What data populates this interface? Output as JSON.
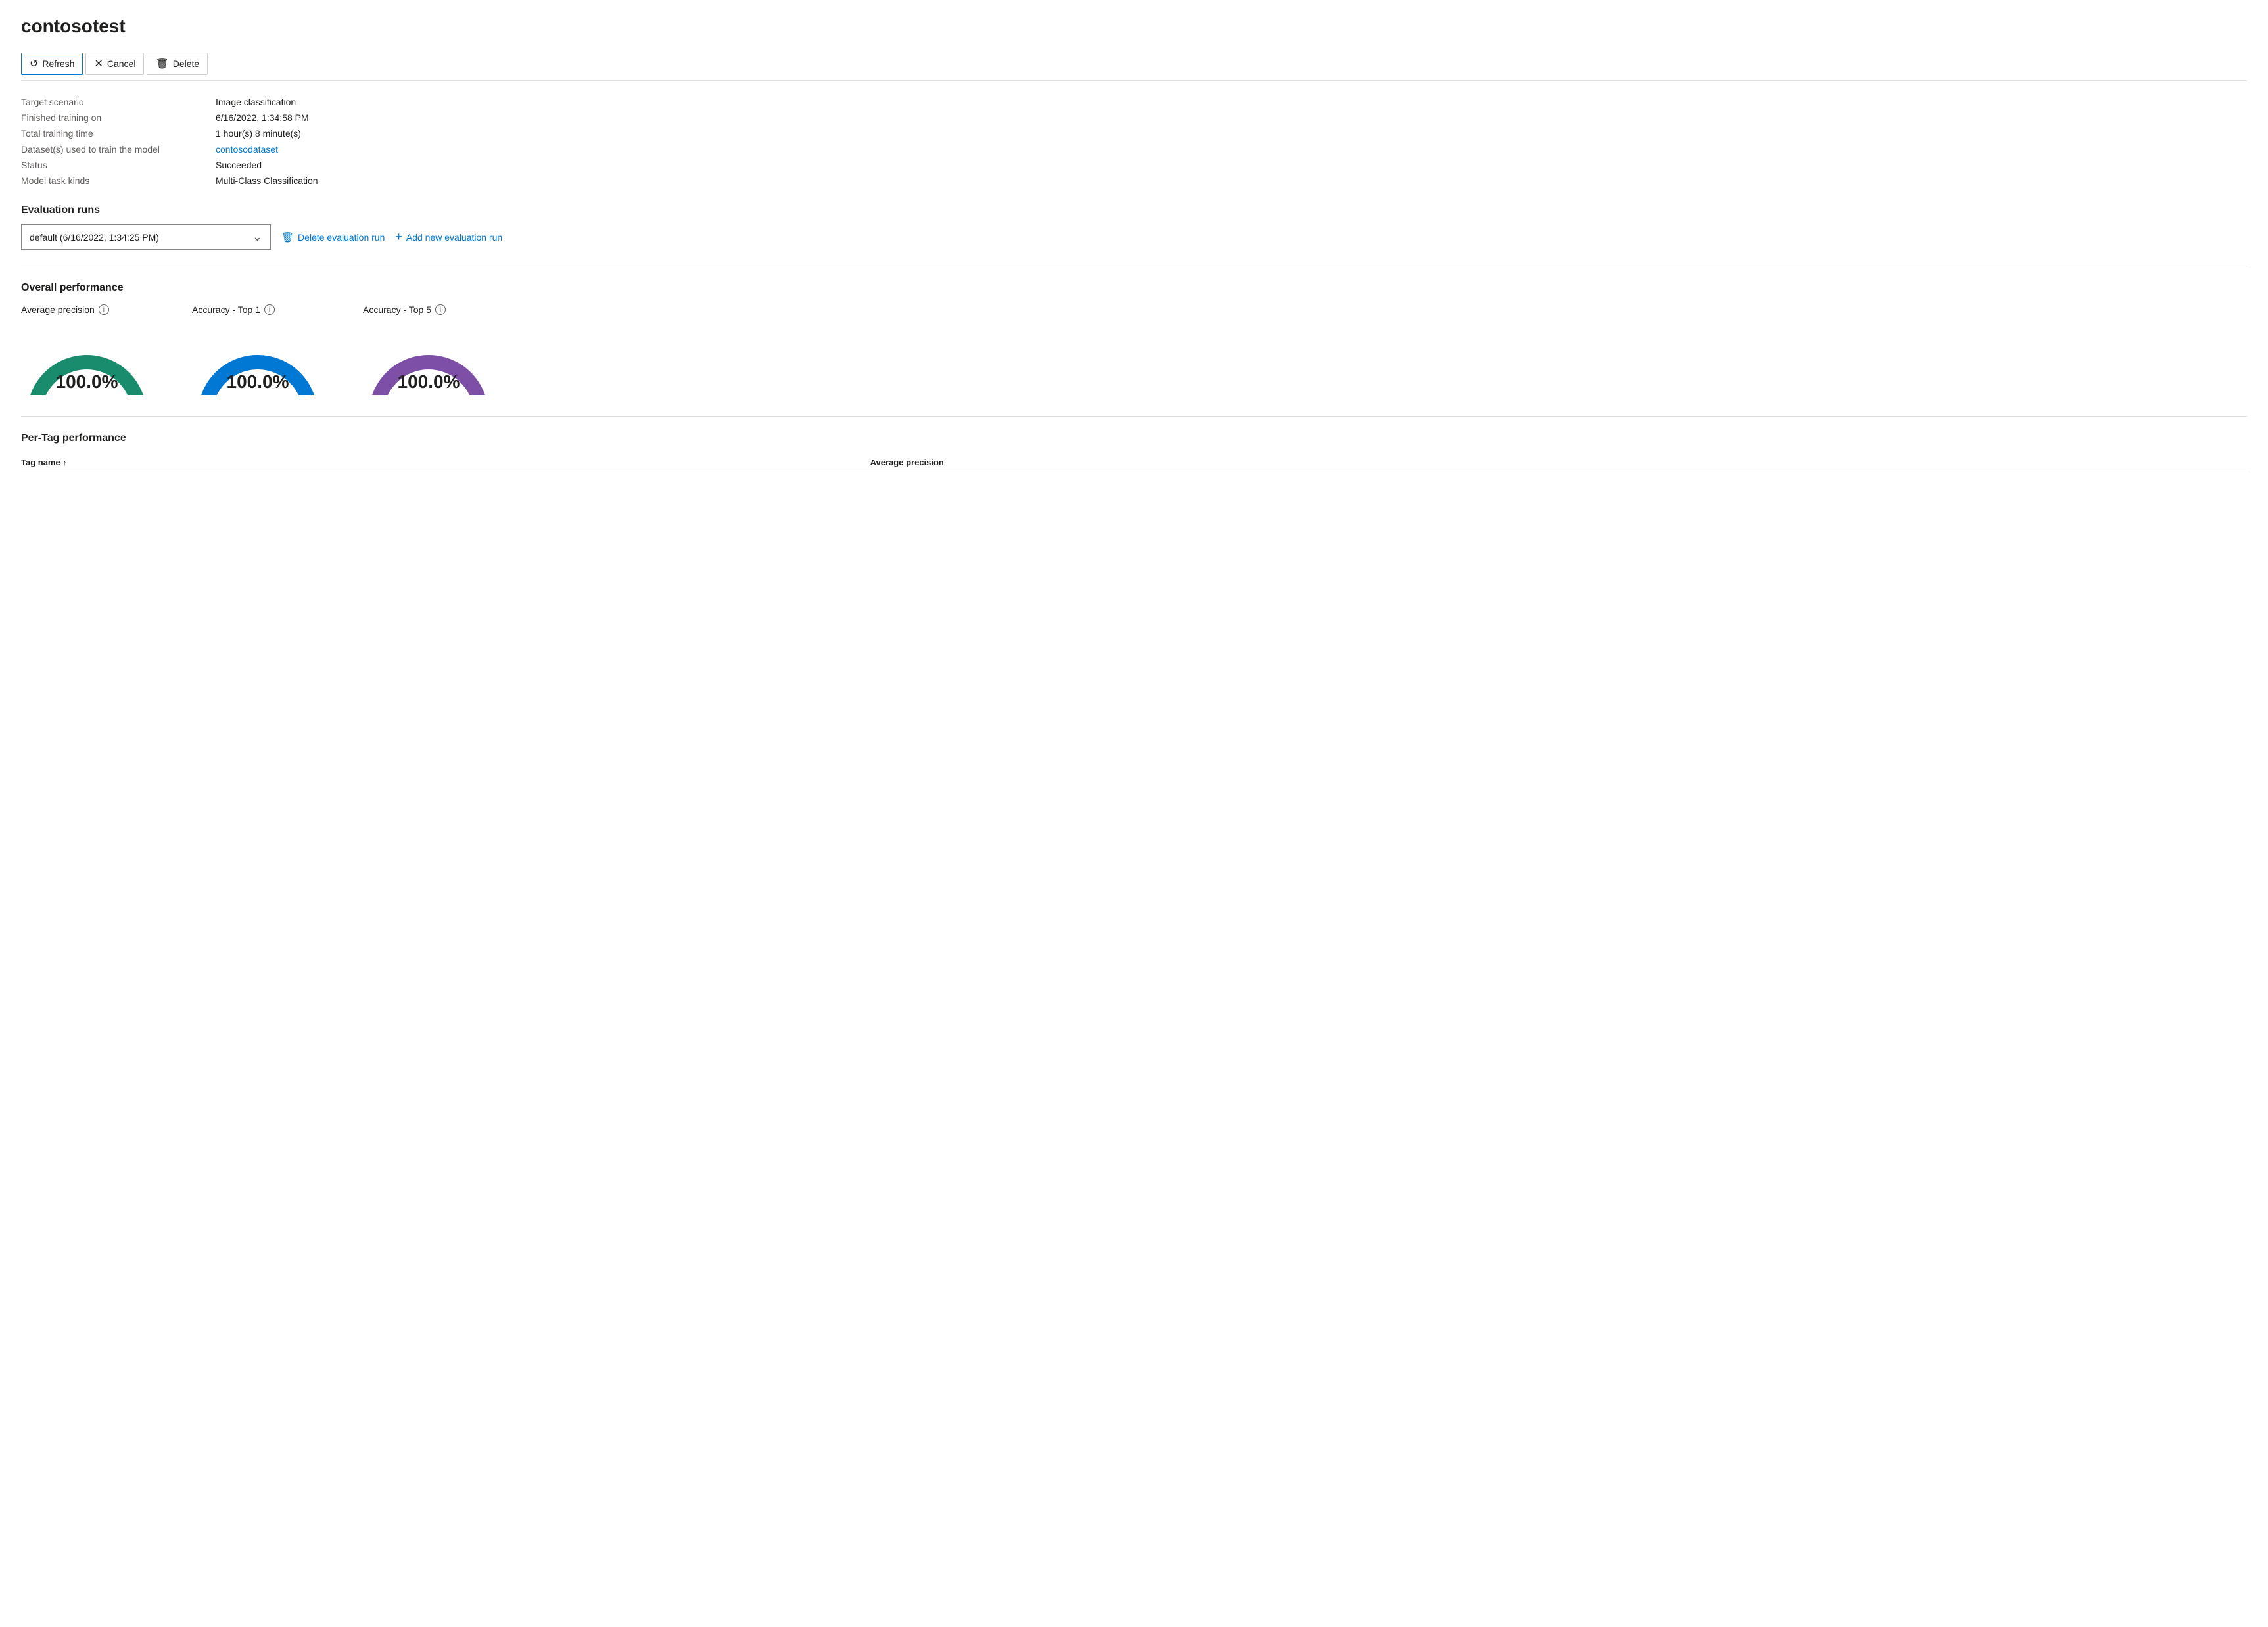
{
  "page": {
    "title": "contosotest"
  },
  "toolbar": {
    "refresh_label": "Refresh",
    "cancel_label": "Cancel",
    "delete_label": "Delete"
  },
  "info": {
    "fields": [
      {
        "label": "Target scenario",
        "value": "Image classification",
        "type": "text"
      },
      {
        "label": "Finished training on",
        "value": "6/16/2022, 1:34:58 PM",
        "type": "text"
      },
      {
        "label": "Total training time",
        "value": "1 hour(s) 8 minute(s)",
        "type": "text"
      },
      {
        "label": "Dataset(s) used to train the model",
        "value": "contosodataset",
        "type": "link"
      },
      {
        "label": "Status",
        "value": "Succeeded",
        "type": "text"
      },
      {
        "label": "Model task kinds",
        "value": "Multi-Class Classification",
        "type": "text"
      }
    ]
  },
  "evaluation_runs": {
    "section_title": "Evaluation runs",
    "selected_run": "default (6/16/2022, 1:34:25 PM)",
    "delete_label": "Delete evaluation run",
    "add_label": "Add new evaluation run"
  },
  "overall_performance": {
    "section_title": "Overall performance",
    "gauges": [
      {
        "label": "Average precision",
        "value": "100.0%",
        "color": "#1a8c6e"
      },
      {
        "label": "Accuracy - Top 1",
        "value": "100.0%",
        "color": "#0078d4"
      },
      {
        "label": "Accuracy - Top 5",
        "value": "100.0%",
        "color": "#7d4fa7"
      }
    ]
  },
  "per_tag_performance": {
    "section_title": "Per-Tag performance",
    "columns": [
      {
        "label": "Tag name",
        "sortable": true,
        "sort_dir": "asc"
      },
      {
        "label": "Average precision",
        "sortable": false
      }
    ]
  },
  "icons": {
    "refresh": "↺",
    "cancel": "✕",
    "delete": "🗑",
    "chevron_down": "⌄",
    "plus": "+",
    "info": "i"
  }
}
